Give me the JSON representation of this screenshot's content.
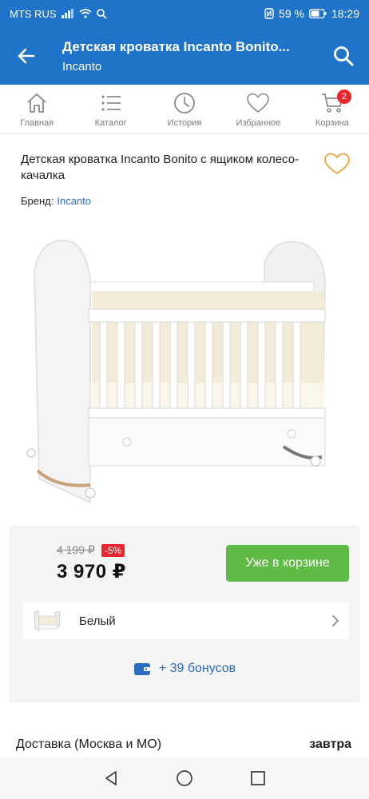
{
  "status": {
    "carrier": "MTS RUS",
    "battery": "59 %",
    "time": "18:29"
  },
  "appbar": {
    "title": "Детская кроватка Incanto Bonito...",
    "subtitle": "Incanto"
  },
  "tabs": [
    {
      "label": "Главная",
      "icon": "home-icon"
    },
    {
      "label": "Каталог",
      "icon": "list-icon"
    },
    {
      "label": "История",
      "icon": "clock-icon"
    },
    {
      "label": "Избранное",
      "icon": "heart-icon"
    },
    {
      "label": "Корзина",
      "icon": "cart-icon",
      "badge": "2"
    }
  ],
  "product": {
    "title": "Детская кроватка Incanto Bonito с ящиком колесо-качалка",
    "brand_label": "Бренд:",
    "brand_value": "Incanto"
  },
  "price": {
    "old": "4 199 ₽",
    "discount": "-5%",
    "current": "3 970 ₽",
    "cart_button": "Уже в корзине"
  },
  "variant": {
    "label": "Белый"
  },
  "bonus": {
    "text": "+ 39 бонусов"
  },
  "delivery": {
    "label": "Доставка (Москва и МО)",
    "when": "завтра"
  },
  "colors": {
    "brand_blue": "#1f73c8",
    "link_blue": "#2a6cbf",
    "cart_green": "#5dbb46",
    "badge_red": "#e8262c",
    "heart_orange": "#f0a23a"
  }
}
